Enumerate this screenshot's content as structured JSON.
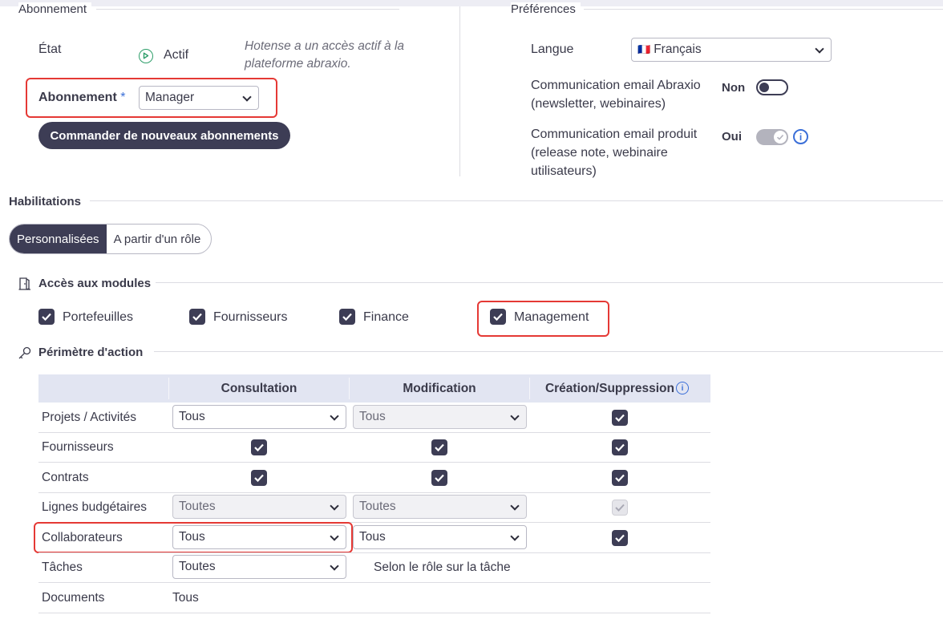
{
  "subscription": {
    "legend": "Abonnement",
    "state_label": "État",
    "state_value": "Actif",
    "state_note": "Hotense a un accès actif à la plateforme abraxio.",
    "plan_label": "Abonnement",
    "required_mark": "*",
    "plan_value": "Manager",
    "order_button": "Commander de nouveaux abonnements"
  },
  "preferences": {
    "legend": "Préférences",
    "language_label": "Langue",
    "language_flag": "🇫🇷",
    "language_value": "Français",
    "newsletter_label": "Communication email Abraxio (newsletter, webinaires)",
    "newsletter_value": "Non",
    "product_label": "Communication email produit (release note, webinaire utilisateurs)",
    "product_value": "Oui"
  },
  "habilitations": {
    "legend": "Habilitations",
    "tabs": [
      {
        "label": "Personnalisées",
        "active": true
      },
      {
        "label": "A partir d'un rôle",
        "active": false
      }
    ],
    "modules_legend": "Accès aux modules",
    "modules": [
      {
        "label": "Portefeuilles",
        "checked": true
      },
      {
        "label": "Fournisseurs",
        "checked": true
      },
      {
        "label": "Finance",
        "checked": true
      },
      {
        "label": "Management",
        "checked": true
      }
    ],
    "scope_legend": "Périmètre d'action",
    "columns": [
      "",
      "Consultation",
      "Modification",
      "Création/Suppression"
    ],
    "rows": [
      {
        "label": "Projets / Activités",
        "consultation": "Tous",
        "modification": "Tous",
        "creation": "checked"
      },
      {
        "label": "Fournisseurs",
        "consultation": "checked",
        "modification": "checked",
        "creation": "checked"
      },
      {
        "label": "Contrats",
        "consultation": "checked",
        "modification": "checked",
        "creation": "checked"
      },
      {
        "label": "Lignes budgétaires",
        "consultation": "Toutes",
        "modification": "Toutes",
        "creation": "checked-disabled"
      },
      {
        "label": "Collaborateurs",
        "consultation": "Tous",
        "modification": "Tous",
        "creation": "checked"
      },
      {
        "label": "Tâches",
        "consultation": "Toutes",
        "modification": "Selon le rôle sur la tâche",
        "creation": ""
      },
      {
        "label": "Documents",
        "consultation": "Tous",
        "modification": "",
        "creation": ""
      }
    ]
  },
  "colors": {
    "accent": "#3d3d55",
    "highlight": "#e53935",
    "info": "#3b6fd8",
    "header_bg": "#e2e5f2"
  }
}
